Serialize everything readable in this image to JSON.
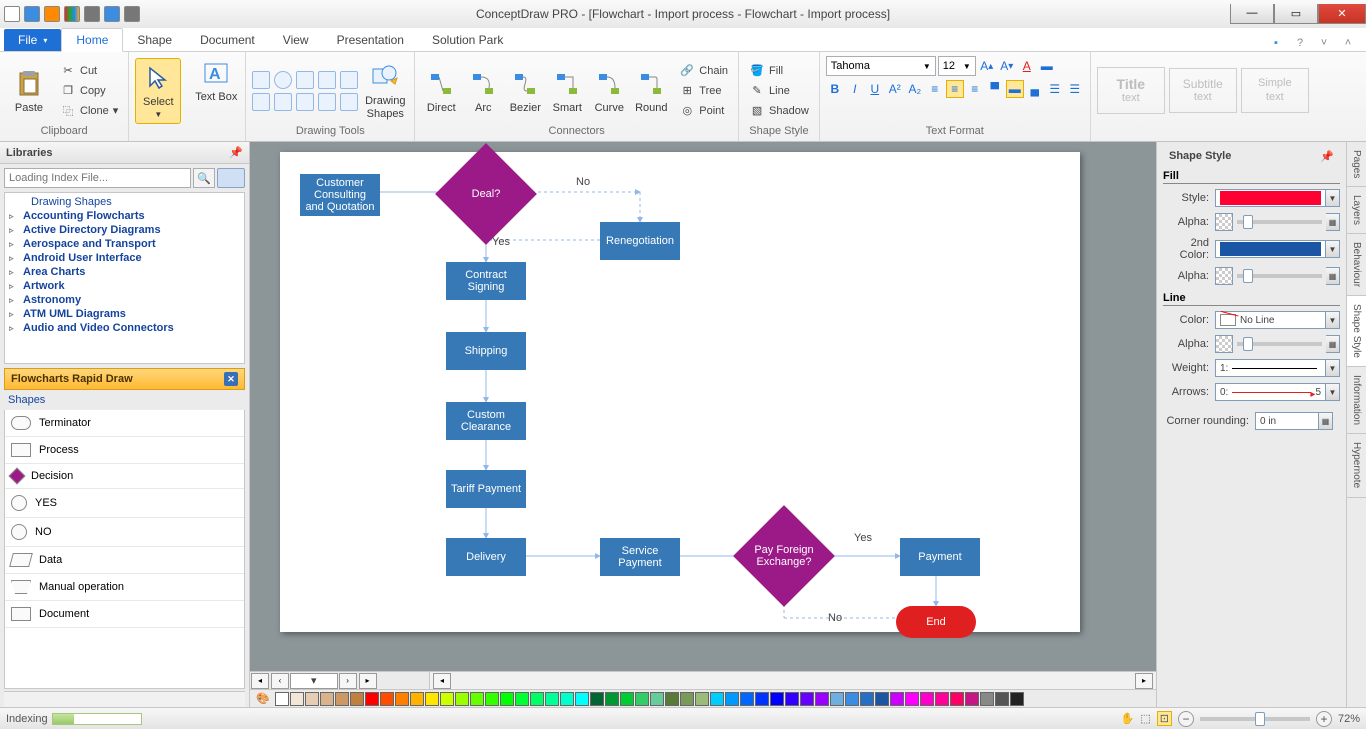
{
  "app": {
    "title": "ConceptDraw PRO - [Flowchart - Import process - Flowchart - Import process]"
  },
  "tabs": {
    "file": "File",
    "items": [
      "Home",
      "Shape",
      "Document",
      "View",
      "Presentation",
      "Solution Park"
    ],
    "active": "Home"
  },
  "ribbon": {
    "clipboard": {
      "paste": "Paste",
      "cut": "Cut",
      "copy": "Copy",
      "clone": "Clone",
      "label": "Clipboard"
    },
    "select": {
      "label": "Select"
    },
    "textbox": {
      "label": "Text Box"
    },
    "drawingShapes": {
      "label": "Drawing Shapes"
    },
    "drawingTools": {
      "label": "Drawing Tools"
    },
    "connectors": {
      "direct": "Direct",
      "arc": "Arc",
      "bezier": "Bezier",
      "smart": "Smart",
      "curve": "Curve",
      "round": "Round",
      "label": "Connectors",
      "chain": "Chain",
      "tree": "Tree",
      "point": "Point"
    },
    "shapeStyle": {
      "fill": "Fill",
      "line": "Line",
      "shadow": "Shadow",
      "label": "Shape Style"
    },
    "textFormat": {
      "font": "Tahoma",
      "size": "12",
      "label": "Text Format"
    },
    "placeholders": {
      "title1": "Title",
      "title2": "text",
      "sub1": "Subtitle",
      "sub2": "text",
      "simple1": "Simple",
      "simple2": "text"
    }
  },
  "leftPanel": {
    "title": "Libraries",
    "searchPlaceholder": "Loading Index File...",
    "tree": [
      "Drawing Shapes",
      "Accounting Flowcharts",
      "Active Directory Diagrams",
      "Aerospace and Transport",
      "Android User Interface",
      "Area Charts",
      "Artwork",
      "Astronomy",
      "ATM UML Diagrams",
      "Audio and Video Connectors"
    ],
    "section": "Flowcharts Rapid Draw",
    "shapesHdr": "Shapes",
    "shapes": [
      "Terminator",
      "Process",
      "Decision",
      "YES",
      "NO",
      "Data",
      "Manual operation",
      "Document"
    ]
  },
  "flowchart": {
    "nodes": {
      "consult": "Customer Consulting and Quotation",
      "deal": "Deal?",
      "reneg": "Renegotiation",
      "contract": "Contract Signing",
      "shipping": "Shipping",
      "custom": "Custom Clearance",
      "tariff": "Tariff Payment",
      "delivery": "Delivery",
      "service": "Service Payment",
      "payfx": "Pay Foreign Exchange?",
      "payment": "Payment",
      "end": "End"
    },
    "labels": {
      "no": "No",
      "yes": "Yes",
      "no2": "No",
      "yes2": "Yes"
    }
  },
  "rightPanel": {
    "title": "Shape Style",
    "fill": "Fill",
    "line": "Line",
    "style": "Style:",
    "alpha": "Alpha:",
    "secondColor": "2nd Color:",
    "color": "Color:",
    "weight": "Weight:",
    "arrows": "Arrows:",
    "cornerRounding": "Corner rounding:",
    "cornerValue": "0 in",
    "noLine": "No Line",
    "weightVal": "1:",
    "arrowsVal": "0:",
    "arrowsEnd": "5",
    "vtabs": [
      "Pages",
      "Layers",
      "Behaviour",
      "Shape Style",
      "Information",
      "Hypernote"
    ]
  },
  "status": {
    "left": "Indexing",
    "zoom": "72%"
  },
  "colorRow": [
    "#ffffff",
    "#f2e6d9",
    "#e6ccb3",
    "#d9b38c",
    "#cc9966",
    "#bf8040",
    "#ff0000",
    "#ff4d00",
    "#ff8000",
    "#ffb300",
    "#ffe600",
    "#ccff00",
    "#99ff00",
    "#66ff00",
    "#33ff00",
    "#00ff00",
    "#00ff33",
    "#00ff66",
    "#00ff99",
    "#00ffcc",
    "#00ffff",
    "#006633",
    "#009933",
    "#00cc33",
    "#33cc66",
    "#66cc99",
    "#5a7a3a",
    "#7a9a5a",
    "#9abb7a",
    "#00ccff",
    "#0099ff",
    "#0066ff",
    "#0033ff",
    "#0000ff",
    "#3300ff",
    "#6600ff",
    "#9900ff",
    "#6faee0",
    "#3a8de0",
    "#2570c4",
    "#1a56a3",
    "#cc00ff",
    "#ff00ff",
    "#ff00cc",
    "#ff0099",
    "#ff0066",
    "#c71585",
    "#888888",
    "#555555",
    "#222222"
  ]
}
